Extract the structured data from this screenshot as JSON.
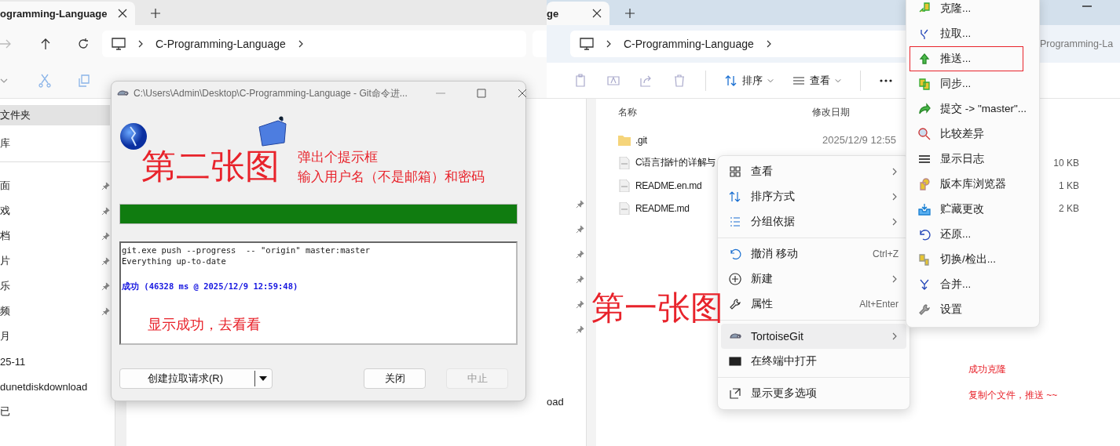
{
  "left_window": {
    "tab": {
      "label": "ogramming-Language"
    },
    "address": {
      "segments": [
        "C-Programming-Language"
      ]
    },
    "sidebar": {
      "header": {
        "label": "文件夹",
        "selected": true
      },
      "top_items": [
        {
          "label": "库",
          "selected": false
        }
      ],
      "items": [
        {
          "label": "面",
          "pinned": true
        },
        {
          "label": "戏",
          "pinned": true
        },
        {
          "label": "档",
          "pinned": true
        },
        {
          "label": "片",
          "pinned": true
        },
        {
          "label": "乐",
          "pinned": true
        },
        {
          "label": "频",
          "pinned": true
        },
        {
          "label": "月",
          "pinned": false
        },
        {
          "label": "25-11",
          "pinned": false
        },
        {
          "label": "dunetdiskdownload",
          "pinned": false
        },
        {
          "label": "已",
          "pinned": false
        }
      ]
    }
  },
  "right_window": {
    "tab": {
      "label": "ge"
    },
    "address": {
      "segments": [
        "C-Programming-Language"
      ]
    },
    "back_window_address": "Programming-La",
    "toolbar": {
      "sort": "排序",
      "view": "查看"
    },
    "sidebar": {
      "items": [
        {
          "pinned": true
        },
        {
          "pinned": true
        },
        {
          "pinned": true
        },
        {
          "pinned": true
        },
        {
          "pinned": true
        },
        {
          "pinned": true
        },
        {
          "label": "oad",
          "pinned": false
        }
      ]
    },
    "columns": [
      "名称",
      "修改日期"
    ],
    "files": [
      {
        "kind": "folder",
        "name": ".git",
        "modified": "2025/12/9 12:55"
      },
      {
        "kind": "file",
        "name": "C语言指针的详解与",
        "size": "10 KB"
      },
      {
        "kind": "file",
        "name": "README.en.md",
        "size": "1 KB"
      },
      {
        "kind": "file",
        "name": "README.md",
        "size": "2 KB"
      }
    ],
    "annotations": {
      "heading": "第一张图",
      "notes": [
        "成功克隆",
        "复制个文件，推送 ~~"
      ]
    }
  },
  "context_menu": [
    {
      "kind": "item",
      "label": "查看",
      "submenu": true,
      "selected": false
    },
    {
      "kind": "item",
      "label": "排序方式",
      "submenu": true,
      "selected": false
    },
    {
      "kind": "item",
      "label": "分组依据",
      "submenu": true,
      "selected": false
    },
    {
      "kind": "separator"
    },
    {
      "kind": "item",
      "label": "撤消 移动",
      "shortcut": "Ctrl+Z",
      "submenu": false,
      "selected": false
    },
    {
      "kind": "item",
      "label": "新建",
      "submenu": true,
      "selected": false
    },
    {
      "kind": "item",
      "label": "属性",
      "shortcut": "Alt+Enter",
      "submenu": false,
      "selected": false
    },
    {
      "kind": "separator"
    },
    {
      "kind": "item",
      "label": "TortoiseGit",
      "submenu": true,
      "selected": true
    },
    {
      "kind": "item",
      "label": "在终端中打开",
      "submenu": false,
      "selected": false
    },
    {
      "kind": "separator"
    },
    {
      "kind": "item",
      "label": "显示更多选项",
      "submenu": false,
      "selected": false
    }
  ],
  "tortoisegit_menu": [
    {
      "label": "克隆...",
      "boxed": false
    },
    {
      "label": "拉取...",
      "boxed": false
    },
    {
      "label": "推送...",
      "boxed": true
    },
    {
      "label": "同步...",
      "boxed": false
    },
    {
      "label": "提交 -> \"master\"...",
      "boxed": false
    },
    {
      "label": "比较差异",
      "boxed": false
    },
    {
      "label": "显示日志",
      "boxed": false
    },
    {
      "label": "版本库浏览器",
      "boxed": false
    },
    {
      "label": "贮藏更改",
      "boxed": false
    },
    {
      "label": "还原...",
      "boxed": false
    },
    {
      "label": "切换/检出...",
      "boxed": false
    },
    {
      "label": "合并...",
      "boxed": false
    },
    {
      "label": "设置",
      "boxed": false
    }
  ],
  "dialog": {
    "title": "C:\\Users\\Admin\\Desktop\\C-Programming-Language - Git命令进...",
    "progress": {
      "level": 1
    },
    "log": [
      {
        "kind": "plain",
        "text": "git.exe push --progress  -- \"origin\" master:master"
      },
      {
        "kind": "plain",
        "text": "Everything up-to-date"
      },
      {
        "kind": "success",
        "text": "成功 (46328 ms @ 2025/12/9 12:59:48)"
      }
    ],
    "buttons": [
      {
        "kind": "split",
        "label": "创建拉取请求(R)",
        "disabled": false
      },
      {
        "kind": "plain",
        "label": "关闭",
        "disabled": false
      },
      {
        "kind": "plain",
        "label": "中止",
        "disabled": true
      }
    ],
    "annotations": {
      "heading": "第二张图",
      "notes": [
        "弹出个提示框",
        "输入用户名（不是邮箱）和密码"
      ],
      "log_note": "显示成功，去看看"
    }
  }
}
